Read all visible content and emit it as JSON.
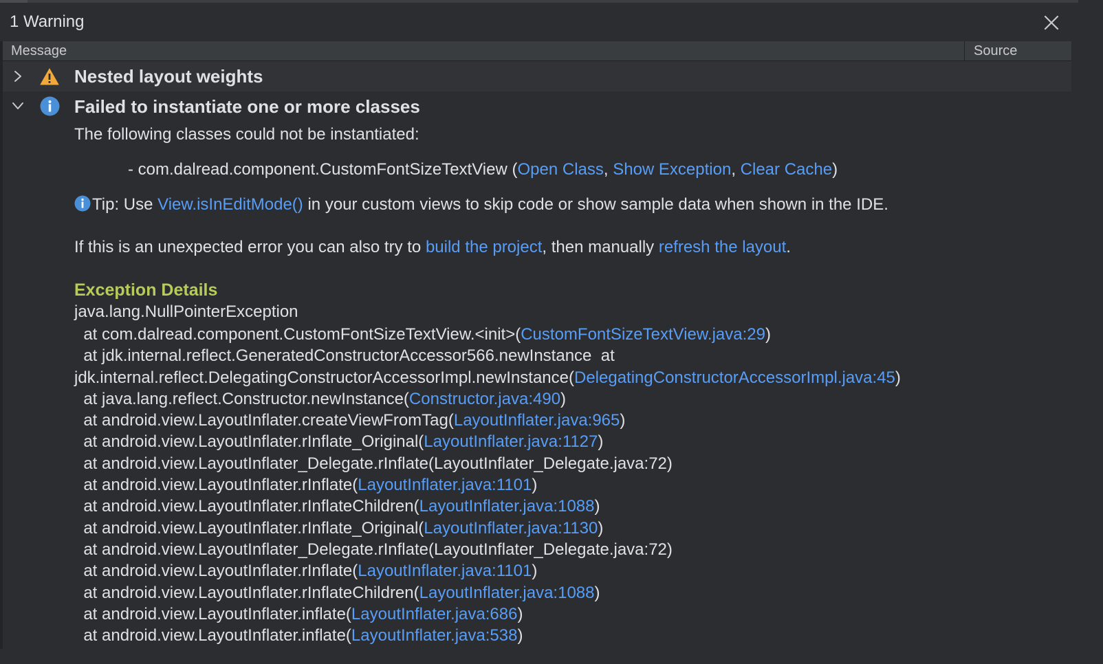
{
  "panel": {
    "title": "1 Warning"
  },
  "columns": {
    "message": "Message",
    "source": "Source"
  },
  "items": [
    {
      "title": "Nested layout weights",
      "icon": "warning-icon",
      "expanded": false
    },
    {
      "title": "Failed to instantiate one or more classes",
      "icon": "info-icon",
      "expanded": true
    }
  ],
  "detail": {
    "intro": "The following classes could not be instantiated:",
    "class_prefix": "- com.dalread.component.CustomFontSizeTextView (",
    "open_class": "Open Class",
    "comma1": ", ",
    "show_exception": "Show Exception",
    "comma2": ", ",
    "clear_cache": "Clear Cache",
    "class_suffix": ")",
    "tip_prefix": "Tip: Use ",
    "tip_link": "View.isInEditMode()",
    "tip_suffix": " in your custom views to skip code or show sample data when shown in the IDE.",
    "retry_prefix": "If this is an unexpected error you can also try to ",
    "build_link": "build the project",
    "retry_mid": ", then manually ",
    "refresh_link": "refresh the layout",
    "retry_suffix": ".",
    "exception_title": "Exception Details",
    "exception_name": "java.lang.NullPointerException"
  },
  "trace": [
    {
      "pre": "  at com.dalread.component.CustomFontSizeTextView.<init>(",
      "link": "CustomFontSizeTextView.java:29",
      "post": ")"
    },
    {
      "pre": "  at jdk.internal.reflect.GeneratedConstructorAccessor566.newInstance  at",
      "link": "",
      "post": ""
    },
    {
      "pre": "jdk.internal.reflect.DelegatingConstructorAccessorImpl.newInstance(",
      "link": "DelegatingConstructorAccessorImpl.java:45",
      "post": ")"
    },
    {
      "pre": "  at java.lang.reflect.Constructor.newInstance(",
      "link": "Constructor.java:490",
      "post": ")"
    },
    {
      "pre": "  at android.view.LayoutInflater.createViewFromTag(",
      "link": "LayoutInflater.java:965",
      "post": ")"
    },
    {
      "pre": "  at android.view.LayoutInflater.rInflate_Original(",
      "link": "LayoutInflater.java:1127",
      "post": ")"
    },
    {
      "pre": "  at android.view.LayoutInflater_Delegate.rInflate(LayoutInflater_Delegate.java:72)",
      "link": "",
      "post": ""
    },
    {
      "pre": "  at android.view.LayoutInflater.rInflate(",
      "link": "LayoutInflater.java:1101",
      "post": ")"
    },
    {
      "pre": "  at android.view.LayoutInflater.rInflateChildren(",
      "link": "LayoutInflater.java:1088",
      "post": ")"
    },
    {
      "pre": "  at android.view.LayoutInflater.rInflate_Original(",
      "link": "LayoutInflater.java:1130",
      "post": ")"
    },
    {
      "pre": "  at android.view.LayoutInflater_Delegate.rInflate(LayoutInflater_Delegate.java:72)",
      "link": "",
      "post": ""
    },
    {
      "pre": "  at android.view.LayoutInflater.rInflate(",
      "link": "LayoutInflater.java:1101",
      "post": ")"
    },
    {
      "pre": "  at android.view.LayoutInflater.rInflateChildren(",
      "link": "LayoutInflater.java:1088",
      "post": ")"
    },
    {
      "pre": "  at android.view.LayoutInflater.inflate(",
      "link": "LayoutInflater.java:686",
      "post": ")"
    },
    {
      "pre": "  at android.view.LayoutInflater.inflate(",
      "link": "LayoutInflater.java:538",
      "post": ")"
    }
  ],
  "colors": {
    "background": "#2b2d30",
    "link": "#589df6",
    "exception_title": "#b5cc5c",
    "warning_icon": "#f2a93b",
    "info_icon": "#4a90d9"
  }
}
